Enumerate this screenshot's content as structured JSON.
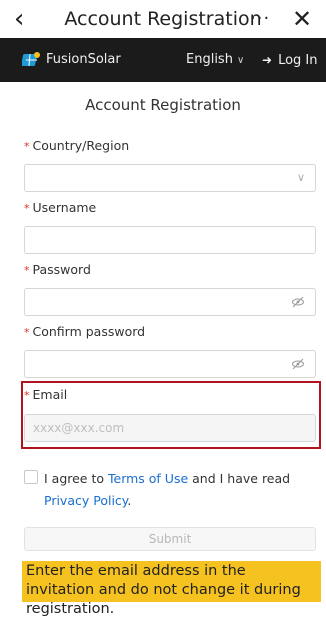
{
  "titlebar": {
    "back_glyph": "‹",
    "title": "Account Registration",
    "more_glyph": "···",
    "close_glyph": "✕"
  },
  "appbar": {
    "brand": "FusionSolar",
    "language": "English",
    "login": "Log In",
    "logo_icon": "fusionsolar-logo-icon",
    "login_icon": "login-arrow-icon"
  },
  "form": {
    "heading": "Account Registration",
    "required_mark": "*",
    "country": {
      "label": "Country/Region",
      "value": "",
      "placeholder": ""
    },
    "username": {
      "label": "Username",
      "value": "",
      "placeholder": ""
    },
    "password": {
      "label": "Password",
      "value": "",
      "placeholder": ""
    },
    "confirm": {
      "label": "Confirm password",
      "value": "",
      "placeholder": ""
    },
    "email": {
      "label": "Email",
      "value": "",
      "placeholder": "xxxx@xxx.com"
    },
    "agree": {
      "text1": "I agree to ",
      "terms": "Terms of Use",
      "text2": " and I have read",
      "privacy": "Privacy Policy",
      "period": "."
    },
    "submit": "Submit"
  },
  "note": "Enter the email address in the invitation and do not change it during registration.",
  "colors": {
    "accent_link": "#1a6fd0",
    "required": "#e0302a",
    "highlight": "#b0141f",
    "note_bg": "#f6c21f",
    "appbar_bg": "#1b1b1b"
  }
}
